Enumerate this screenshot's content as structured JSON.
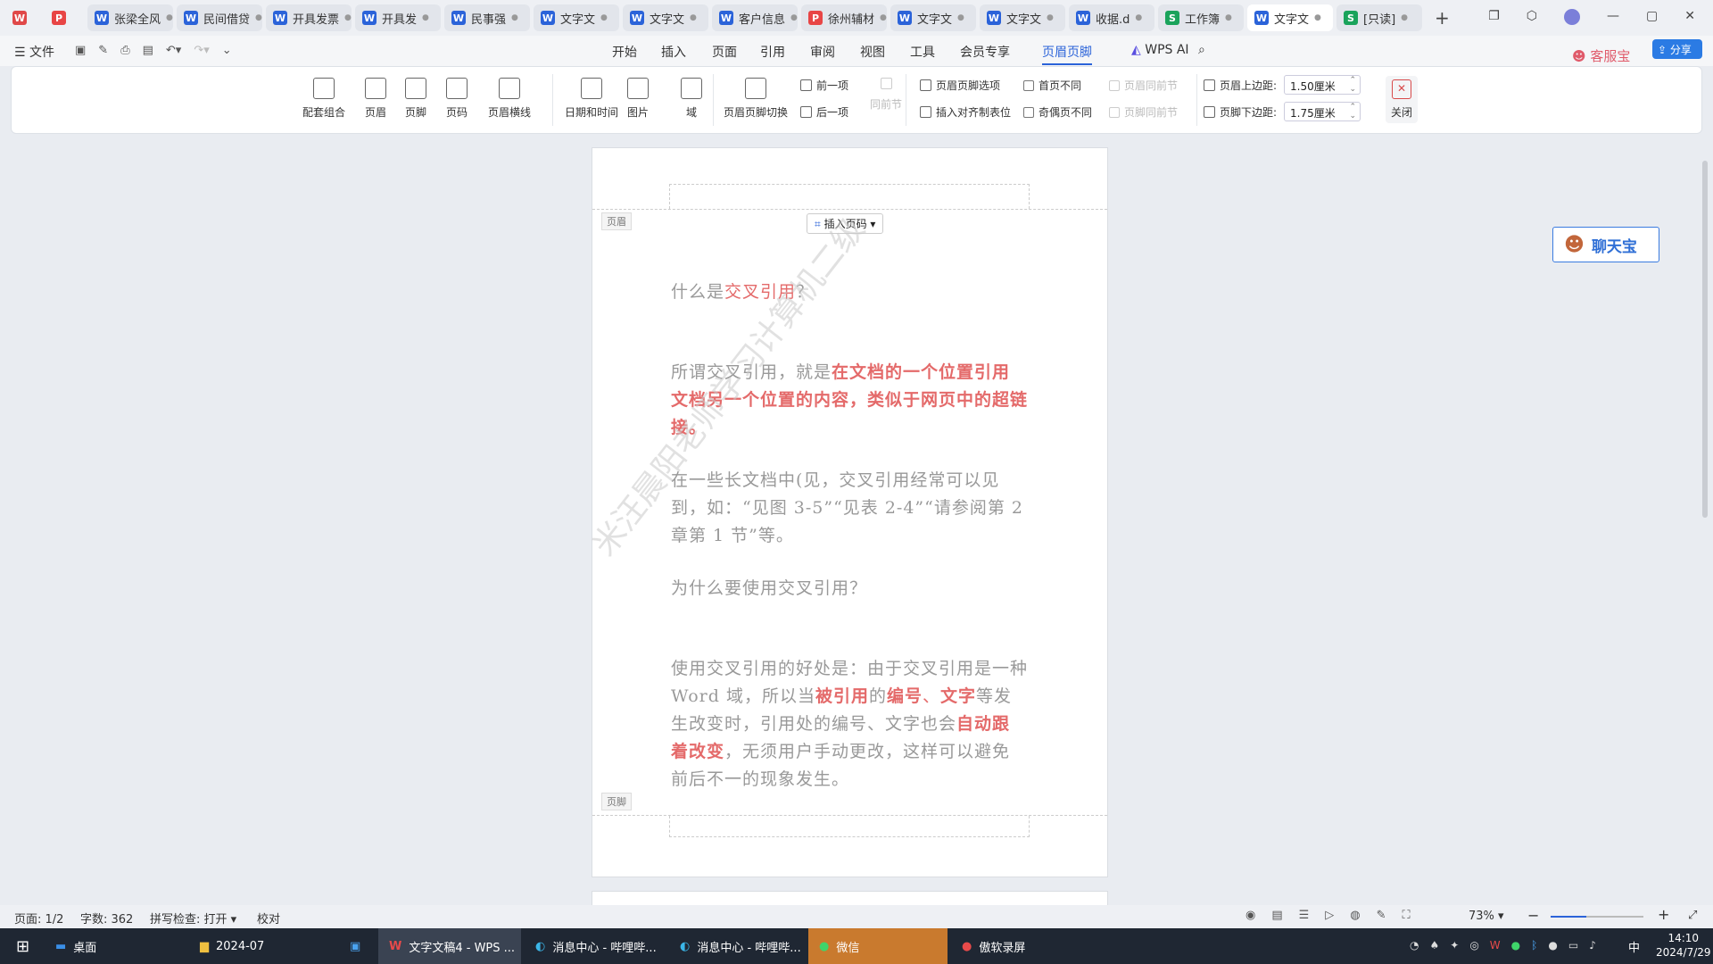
{
  "tabs": [
    {
      "label": "张梁全风",
      "type": "w"
    },
    {
      "label": "民间借贷",
      "type": "w"
    },
    {
      "label": "开具发票",
      "type": "w"
    },
    {
      "label": "开具发",
      "type": "w"
    },
    {
      "label": "民事强",
      "type": "w"
    },
    {
      "label": "文字文",
      "type": "w"
    },
    {
      "label": "文字文",
      "type": "w"
    },
    {
      "label": "客户信息",
      "type": "w"
    },
    {
      "label": "徐州辅材",
      "type": "p"
    },
    {
      "label": "文字文",
      "type": "w"
    },
    {
      "label": "文字文",
      "type": "w"
    },
    {
      "label": "收据.d",
      "type": "w"
    },
    {
      "label": "工作簿",
      "type": "s"
    },
    {
      "label": "文字文",
      "type": "w"
    },
    {
      "label": "[只读]",
      "type": "s"
    }
  ],
  "menu": {
    "file": "文件",
    "items": [
      "开始",
      "插入",
      "页面",
      "引用",
      "审阅",
      "视图",
      "工具",
      "会员专享",
      "页眉页脚"
    ],
    "wps_ai": "WPS AI",
    "share": "分享",
    "kefu": "客服宝"
  },
  "ribbon": {
    "combo": "配套组合",
    "header": "页眉",
    "footer": "页脚",
    "pageno": "页码",
    "hline": "页眉横线",
    "datetime": "日期和时间",
    "picture": "图片",
    "field": "域",
    "switch": "页眉页脚切换",
    "prev": "前一项",
    "next": "后一项",
    "same_prev": "同前节",
    "options": "页眉页脚选项",
    "align_tab": "插入对齐制表位",
    "first_diff": "首页不同",
    "odd_even": "奇偶页不同",
    "hdr_same": "页眉同前节",
    "ftr_same": "页脚同前节",
    "top_margin_label": "页眉上边距:",
    "top_margin": "1.50厘米",
    "bottom_margin_label": "页脚下边距:",
    "bottom_margin": "1.75厘米",
    "close": "关闭"
  },
  "doc": {
    "header_tag": "页眉",
    "footer_tag": "页脚",
    "insert_pageno": "插入页码",
    "q1_a": "什么是",
    "q1_b": "交叉引用",
    "q1_c": "？",
    "p1_a": "所谓交叉引用，就是",
    "p1_b": "在文档的一个位置引用文档另一个位置的内容，类似于网页中的超链接。",
    "p2": "在一些长文档中(见，交叉引用经常可以见到，如：“见图 3-5”“见表 2-4”“请参阅第 2 章第 1 节”等。",
    "q2": "为什么要使用交叉引用？",
    "p3_a": "使用交叉引用的好处是：由于交叉引用是一种 Word 域，所以当",
    "p3_b": "被引用",
    "p3_c": "的",
    "p3_d": "编号",
    "p3_e": "、",
    "p3_f": "文字",
    "p3_g": "等发生改变时，引用处的编号、文字也会",
    "p3_h": "自动跟着改变",
    "p3_i": "，无须用户手动更改，这样可以避免前后不一的现象发生。",
    "watermark": "米汪晨阳老师学习计算机二级"
  },
  "chat": "聊天宝",
  "status": {
    "page": "页面: 1/2",
    "words": "字数: 362",
    "spell": "拼写检查: 打开",
    "proof": "校对",
    "zoom": "73%"
  },
  "taskbar": {
    "desktop": "桌面",
    "folder": "2024-07",
    "wps": "文字文稿4 - WPS ...",
    "edge1": "消息中心 - 哔哩哔...",
    "edge2": "消息中心 - 哔哩哔...",
    "wechat": "微信",
    "rec": "傲软录屏",
    "time": "14:10",
    "date": "2024/7/29",
    "ime": "中"
  }
}
